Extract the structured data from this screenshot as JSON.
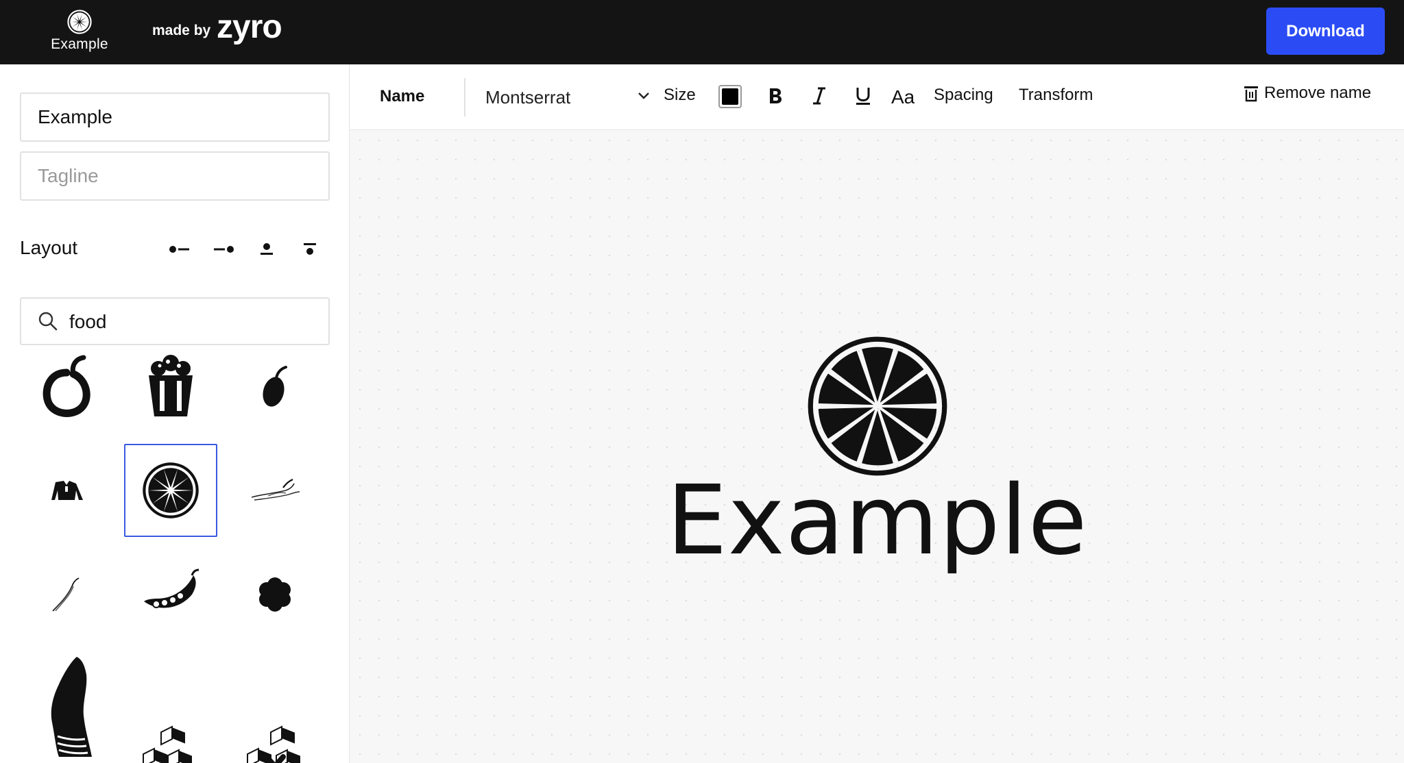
{
  "header": {
    "brand_name": "Example",
    "made_by": "made by",
    "product": "zyro",
    "download_label": "Download"
  },
  "sidebar": {
    "name_value": "Example",
    "tagline_placeholder": "Tagline",
    "layout_label": "Layout",
    "layout_options": [
      "symbol-left",
      "symbol-right",
      "symbol-top",
      "symbol-below"
    ],
    "search_value": "food",
    "icon_results": [
      "pepper-ring-icon",
      "popcorn-icon",
      "olive-icon",
      "shirt-icon",
      "citrus-slice-icon",
      "chili-pepper-icon",
      "small-chili-icon",
      "pea-pod-icon",
      "flower-cookie-icon",
      "ham-leg-icon",
      "sugar-cubes-icon",
      "sugar-cubes-cross-icon"
    ],
    "selected_icon": "citrus-slice-icon"
  },
  "toolbar": {
    "section_label": "Name",
    "font": "Montserrat",
    "size_label": "Size",
    "text_color": "#000000",
    "spacing_label": "Spacing",
    "transform_label": "Transform",
    "remove_label": "Remove name"
  },
  "canvas": {
    "logo_name": "Example"
  },
  "colors": {
    "accent": "#2b4cf5",
    "topbar": "#141414",
    "selection": "#3a5ae0"
  }
}
